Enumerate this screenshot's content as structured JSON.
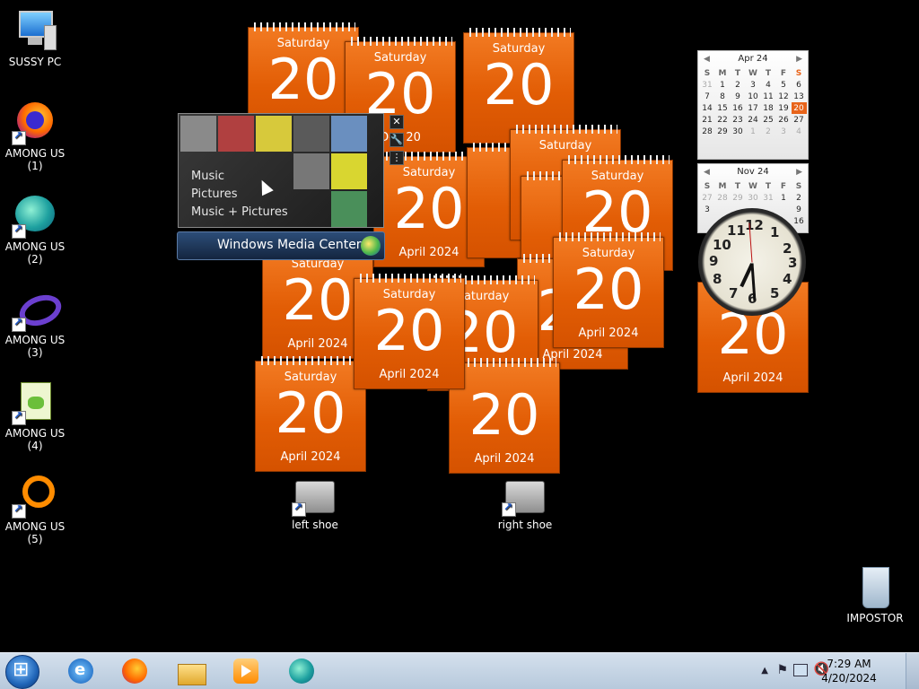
{
  "desktop_icons": [
    {
      "label": "SUSSY PC",
      "icon": "computer-icon"
    },
    {
      "label": "AMONG US\n(1)",
      "icon": "firefox-icon"
    },
    {
      "label": "AMONG US\n(2)",
      "icon": "edge-icon"
    },
    {
      "label": "AMONG US\n(3)",
      "icon": "visual-studio-icon"
    },
    {
      "label": "AMONG US\n(4)",
      "icon": "notepad-icon"
    },
    {
      "label": "AMONG US\n(5)",
      "icon": "ring-app-icon"
    }
  ],
  "drive_icons": [
    {
      "label": "left shoe"
    },
    {
      "label": "right shoe"
    }
  ],
  "recycle_bin": {
    "label": "IMPOSTOR"
  },
  "calendar_gadget": {
    "dow": "Saturday",
    "day": "20",
    "month_year": "April 2024"
  },
  "month_calendar_1": {
    "title": "Apr 24",
    "weekdays": [
      "S",
      "M",
      "T",
      "W",
      "T",
      "F",
      "S"
    ],
    "rows": [
      [
        "31",
        "1",
        "2",
        "3",
        "4",
        "5",
        "6"
      ],
      [
        "7",
        "8",
        "9",
        "10",
        "11",
        "12",
        "13"
      ],
      [
        "14",
        "15",
        "16",
        "17",
        "18",
        "19",
        "20"
      ],
      [
        "21",
        "22",
        "23",
        "24",
        "25",
        "26",
        "27"
      ],
      [
        "28",
        "29",
        "30",
        "1",
        "2",
        "3",
        "4"
      ]
    ]
  },
  "month_calendar_2": {
    "title": "Nov 24",
    "weekdays": [
      "S",
      "M",
      "T",
      "W",
      "T",
      "F",
      "S"
    ],
    "rows": [
      [
        "27",
        "28",
        "29",
        "30",
        "31",
        "1",
        "2"
      ],
      [
        "3",
        "",
        "",
        "",
        "",
        "",
        "9"
      ],
      [
        "",
        "",
        "",
        "",
        "",
        "",
        "16"
      ]
    ]
  },
  "media_center": {
    "menu": [
      "Music",
      "Pictures",
      "Music + Pictures"
    ],
    "title": "Windows Media Center",
    "overlay_text": "Dec 20"
  },
  "clock_numbers": [
    "12",
    "1",
    "2",
    "3",
    "4",
    "5",
    "6",
    "7",
    "8",
    "9",
    "10",
    "11"
  ],
  "taskbar": {
    "time": "7:29 AM",
    "date": "4/20/2024",
    "pinned": [
      "internet-explorer-icon",
      "firefox-icon",
      "file-explorer-icon",
      "media-player-icon",
      "edge-icon"
    ]
  }
}
